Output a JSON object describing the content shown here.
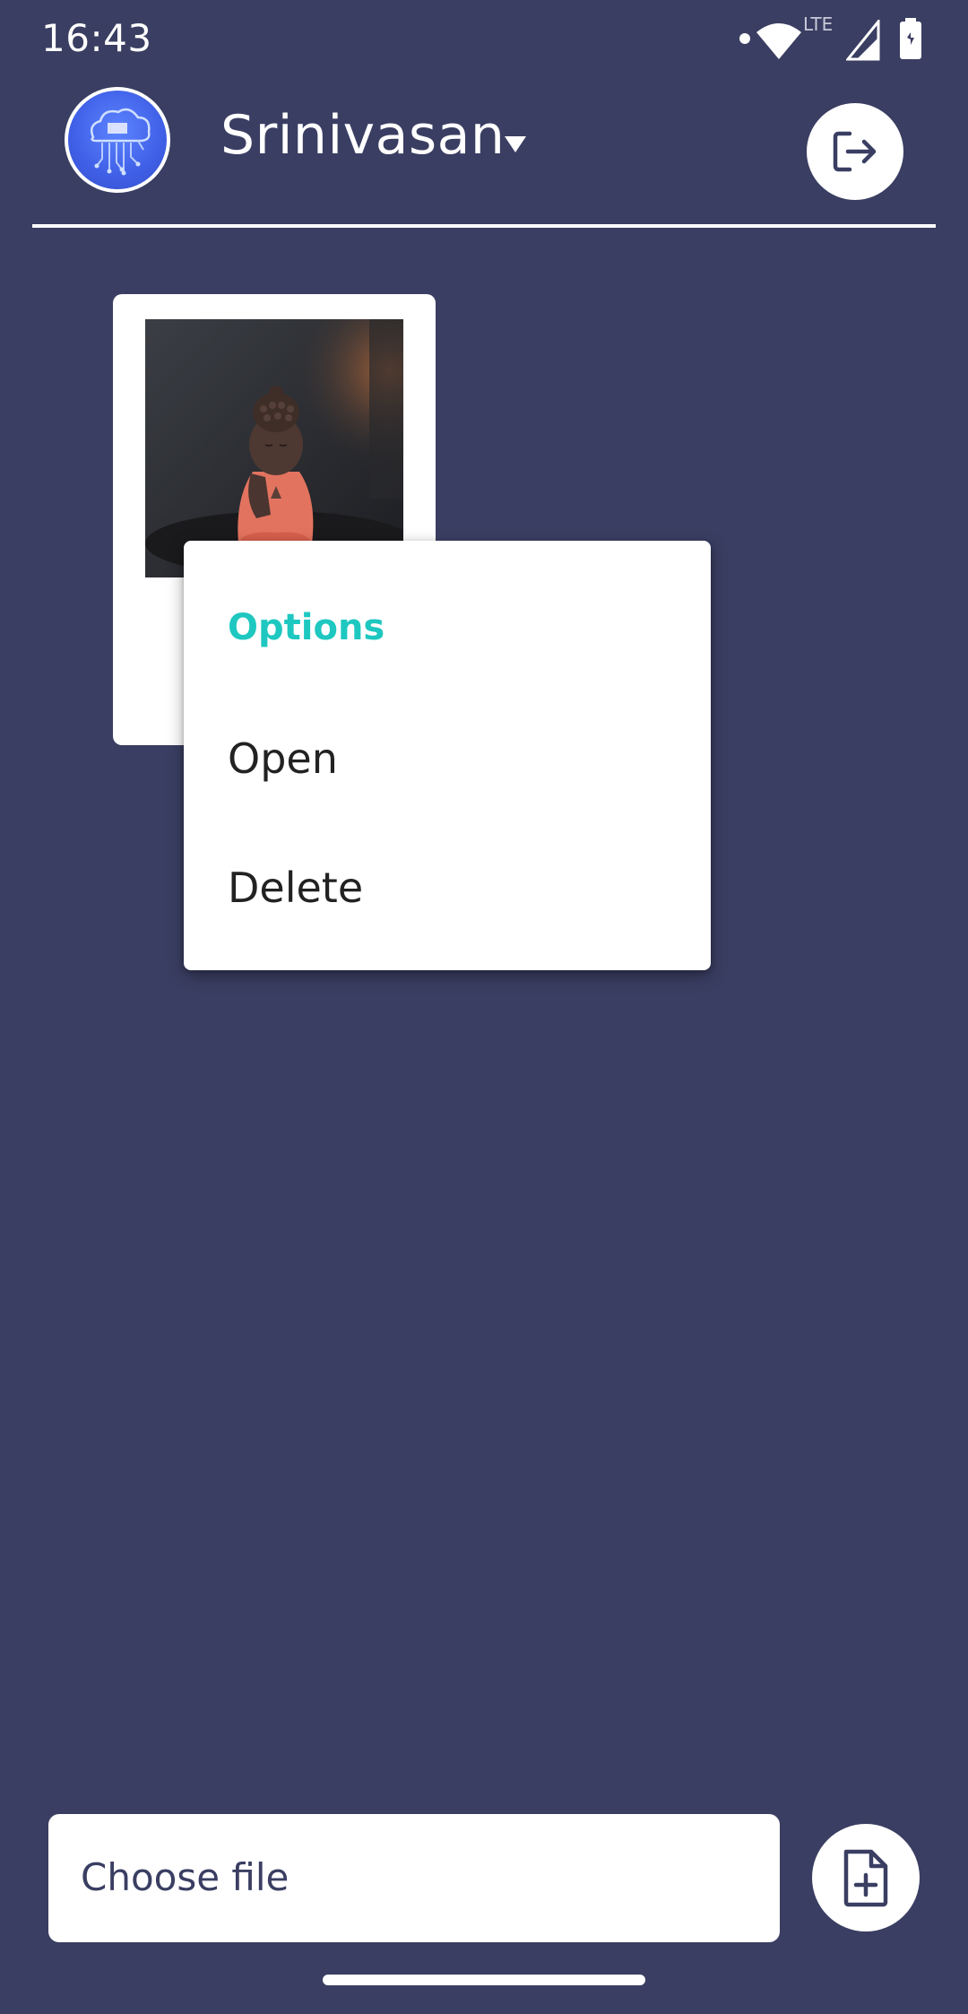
{
  "status_bar": {
    "time": "16:43",
    "network_label": "LTE",
    "icons": [
      "notification-dot-icon",
      "wifi-icon",
      "signal-icon",
      "signal-icon",
      "battery-icon"
    ]
  },
  "header": {
    "user_name": "Srinivasan",
    "logo_icon": "cloud-circuit-logo",
    "logout_icon": "logout-icon"
  },
  "files": [
    {
      "thumbnail": "buddha-figurine-photo"
    }
  ],
  "context_menu": {
    "title": "Options",
    "items": [
      "Open",
      "Delete"
    ]
  },
  "bottom_bar": {
    "choose_file_label": "Choose file",
    "add_file_icon": "file-add-icon"
  },
  "colors": {
    "background": "#3a3e62",
    "menu_title": "#1ec8c0",
    "logo_blue": "#4a6cf0"
  }
}
